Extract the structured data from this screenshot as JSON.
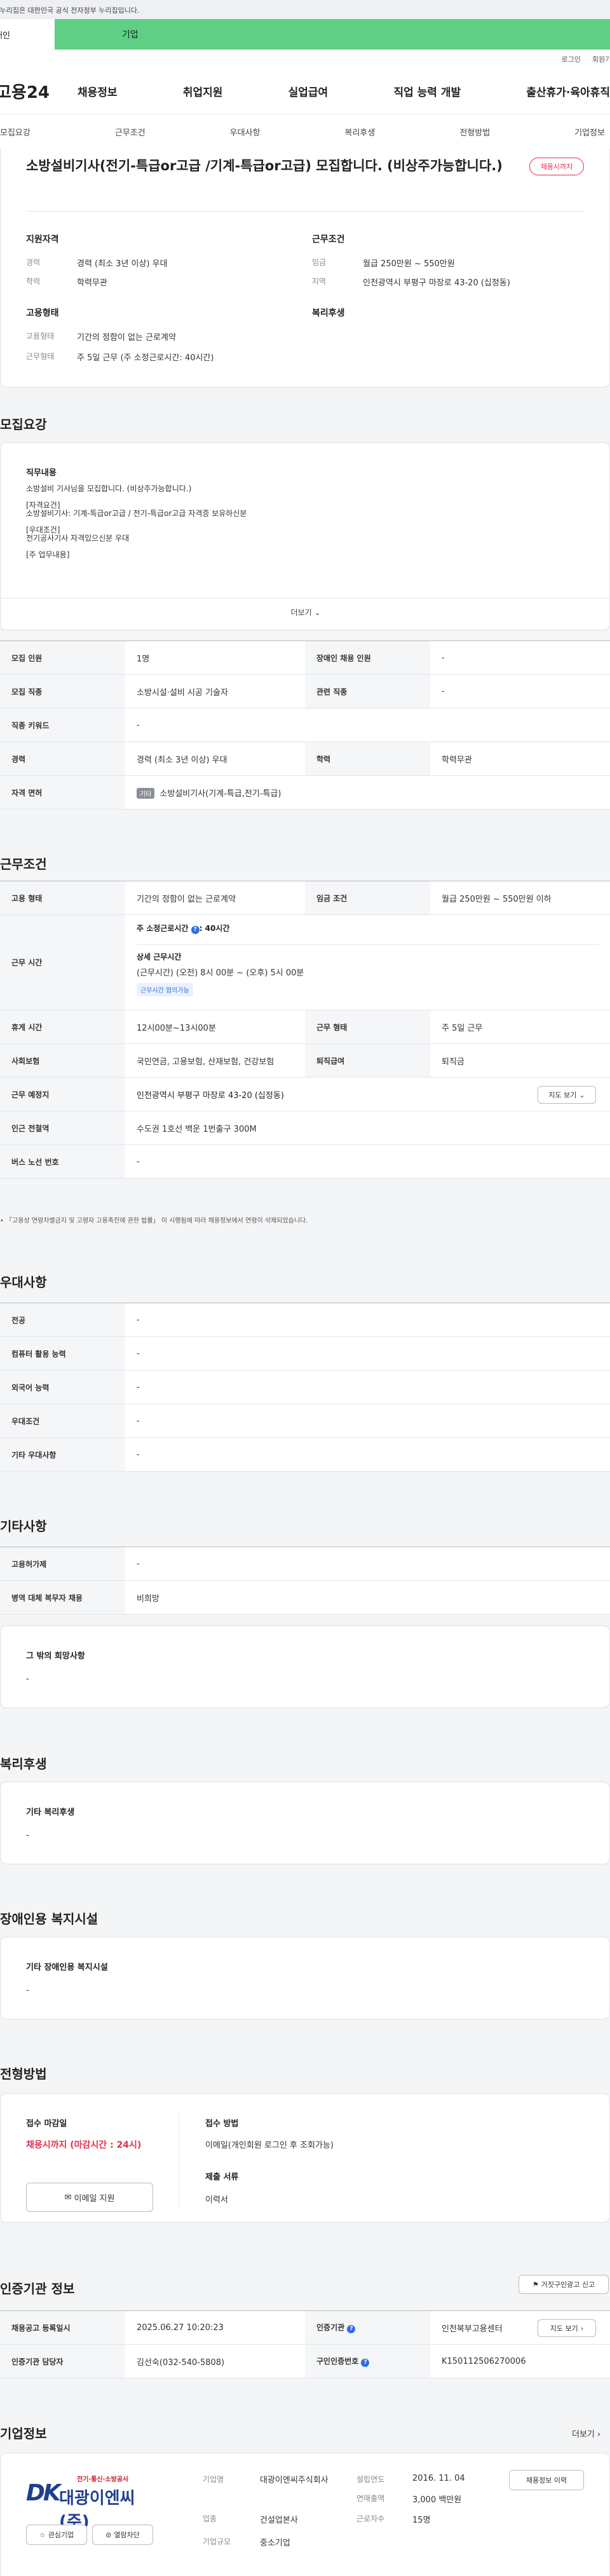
{
  "gov_notice": "이 누리집은 대한민국 공식 전자정부 누리집입니다.",
  "topbar": {
    "left": "개인",
    "right": "기업"
  },
  "util": {
    "login": "로그인",
    "join": "회원가입"
  },
  "logo": "고용24",
  "gnb": [
    "채용정보",
    "취업지원",
    "실업급여",
    "직업 능력 개발",
    "출산휴가·육아휴직"
  ],
  "tabs": [
    "모집요강",
    "근무조건",
    "우대사항",
    "복리후생",
    "전형방법",
    "기업정보"
  ],
  "header_card": {
    "title": "소방설비기사(전기-특급or고급 /기계-특급or고급) 모집합니다. (비상주가능합니다.)",
    "status": "채용시까지",
    "qual_title": "지원자격",
    "qual": [
      {
        "label": "경력",
        "value": "경력 (최소 3년 이상) 우대"
      },
      {
        "label": "학력",
        "value": "학력무관"
      }
    ],
    "cond_title": "근무조건",
    "cond": [
      {
        "label": "임금",
        "value": "월급 250만원 ~ 550만원"
      },
      {
        "label": "지역",
        "value": "인천광역시 부평구 마장로 43-20 (십정동)"
      }
    ],
    "emp_title": "고용형태",
    "emp": [
      {
        "label": "고용형태",
        "value": "기간의 정함이 없는 근로계약"
      },
      {
        "label": "근무형태",
        "value": "주 5일 근무 (주 소정근로시간: 40시간)"
      }
    ],
    "welfare_title": "복리후생"
  },
  "recruit": {
    "title": "모집요강",
    "duty_title": "직무내용",
    "duty_lines": [
      "소방설비 기사님을 모집합니다. (비상주가능합니다.)",
      "",
      "[자격요건]",
      "소방설비기사: 기계-특급or고급 / 전기-특급or고급 자격증 보유하신분",
      "",
      "[우대조건]",
      "전기공사기사 자격있으신분 우대",
      "",
      "[주 업무내용]"
    ],
    "more": "더보기",
    "rows": [
      [
        "모집 인원",
        "1명",
        "장애인 채용 인원",
        "-"
      ],
      [
        "모집 직종",
        "소방시설·설비 시공 기술자",
        "관련 직종",
        "-"
      ],
      [
        "직종 키워드",
        "-",
        "",
        ""
      ],
      [
        "경력",
        "경력 (최소 3년 이상) 우대",
        "학력",
        "학력무관"
      ]
    ],
    "license_label": "자격 면허",
    "license_chip": "기타",
    "license_value": "소방설비기사(기계-특급,전기-특급)"
  },
  "workcond": {
    "title": "근무조건",
    "r1": [
      "고용 형태",
      "기간의 정함이 없는 근로계약",
      "임금 조건",
      "월급 250만원 ~ 550만원 이하"
    ],
    "hours_label": "근무 시간",
    "hours_week": "주 소정근로시간",
    "hours_week_val": ": 40시간",
    "hours_detail_title": "상세 근무시간",
    "hours_detail": "(근무시간) (오전) 8시 00분 ~ (오후) 5시 00분",
    "hours_badge": "근무시간 협의가능",
    "rows": [
      [
        "휴게 시간",
        "12시00분~13시00분",
        "근무 형태",
        "주 5일 근무"
      ],
      [
        "사회보험",
        "국민연금, 고용보험, 산재보험, 건강보험",
        "퇴직급여",
        "퇴직금"
      ]
    ],
    "place_label": "근무 예정지",
    "place": "인천광역시 부평구 마장로 43-20 (십정동)",
    "map_btn": "지도 보기",
    "station_label": "인근 전철역",
    "station": "수도권 1호선 백운 1번출구 300M",
    "bus_label": "버스 노선 번호",
    "bus": "-",
    "note": "「고용상 연령차별금지 및 고령자 고용촉진에 관한 법률」 이 시행됨에 따라 채용정보에서 연령이 삭제되었습니다."
  },
  "prefer": {
    "title": "우대사항",
    "rows": [
      [
        "전공",
        "-"
      ],
      [
        "컴퓨터 활용 능력",
        "-"
      ],
      [
        "외국어 능력",
        "-"
      ],
      [
        "우대조건",
        "-"
      ],
      [
        "기타 우대사항",
        "-"
      ]
    ]
  },
  "etc": {
    "title": "기타사항",
    "rows": [
      [
        "고용허가제",
        "-"
      ],
      [
        "병역 대체 복무자 채용",
        "비희망"
      ]
    ],
    "hope_title": "그 밖의 희망사항",
    "hope": "-"
  },
  "welfare": {
    "title": "복리후생",
    "box_title": "기타 복리후생",
    "box_val": "-"
  },
  "disability": {
    "title": "장애인용 복지시설",
    "box_title": "기타 장애인용 복지시설",
    "box_val": "-"
  },
  "screening": {
    "title": "전형방법",
    "deadline_title": "접수 마감일",
    "deadline": "채용시까지 (마감시간 : 24시)",
    "email_btn": "이메일 지원",
    "method_title": "접수 방법",
    "method": "이메일(개인회원 로그인 후 조회가능)",
    "docs_title": "제출 서류",
    "docs": "이력서"
  },
  "cert": {
    "title": "인증기관 정보",
    "report_btn": "거짓구인광고 신고",
    "r1": [
      "채용공고 등록일시",
      "2025.06.27 10:20:23",
      "인증기관",
      "인천북부고용센터"
    ],
    "map_btn": "지도 보기",
    "r2": [
      "인증기관 담당자",
      "김선숙(032-540-5808)",
      "구인인증번호",
      "K150112506270006"
    ]
  },
  "company": {
    "title": "기업정보",
    "more": "더보기",
    "logo_sub": "전기·통신·소방공사",
    "logo_main": "대광이엔씨(주)",
    "logo_mark": "DK",
    "fav_btn": "관심기업",
    "block_btn": "열람차단",
    "name_label": "기업명",
    "name": "대광이엔씨주식회사",
    "industry_label": "업종",
    "industry": "건설업본사",
    "size_label": "기업규모",
    "size": "중소기업",
    "founded_label": "설립연도",
    "founded": "2016. 11. 04",
    "sales_label": "연매출액",
    "sales": "3,000 백만원",
    "staff_label": "근로자수",
    "staff": "15명",
    "jobs_btn": "채용정보 이력"
  }
}
